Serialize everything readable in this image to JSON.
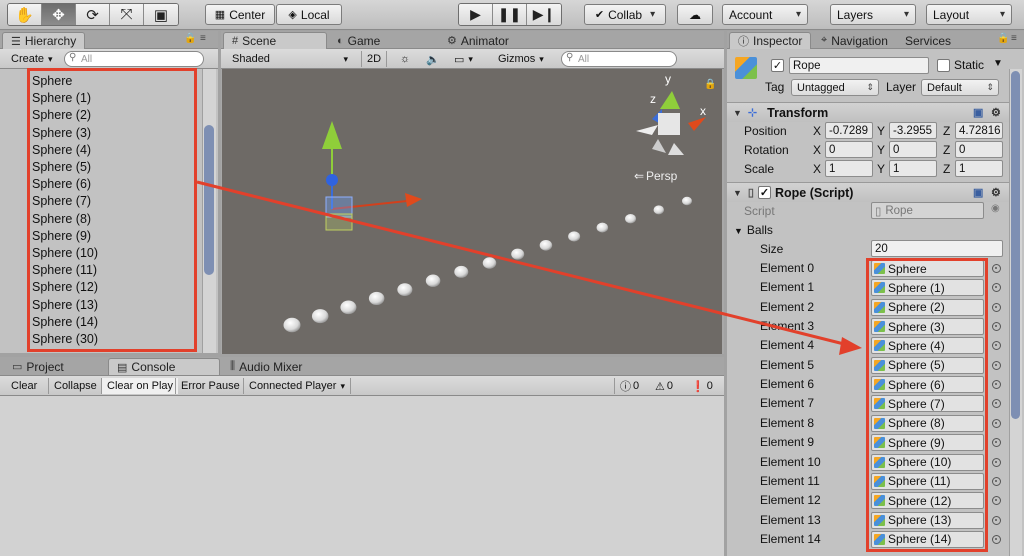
{
  "toolbar": {
    "pivot_label": "Center",
    "space_label": "Local",
    "collab_label": "Collab",
    "account_label": "Account",
    "layers_label": "Layers",
    "layout_label": "Layout"
  },
  "hierarchy": {
    "tab_label": "Hierarchy",
    "create_label": "Create",
    "search_placeholder": "All",
    "items": [
      "Sphere",
      "Sphere (1)",
      "Sphere (2)",
      "Sphere (3)",
      "Sphere (4)",
      "Sphere (5)",
      "Sphere (6)",
      "Sphere (7)",
      "Sphere (8)",
      "Sphere (9)",
      "Sphere (10)",
      "Sphere (11)",
      "Sphere (12)",
      "Sphere (13)",
      "Sphere (14)",
      "Sphere (30)"
    ]
  },
  "scene": {
    "tabs": [
      "Scene",
      "Game",
      "Animator"
    ],
    "shading_mode": "Shaded",
    "mode_2d": "2D",
    "gizmos_label": "Gizmos",
    "search_placeholder": "All",
    "persp_label": "Persp",
    "axis_labels": {
      "y": "y",
      "z": "z",
      "x": "x"
    }
  },
  "bottom": {
    "tabs": [
      "Project",
      "Console",
      "Audio Mixer"
    ],
    "buttons": [
      "Clear",
      "Collapse",
      "Clear on Play",
      "Error Pause",
      "Connected Player"
    ],
    "counts": {
      "errors": "0",
      "warnings": "0",
      "messages": "0"
    }
  },
  "inspector": {
    "tabs": [
      "Inspector",
      "Navigation",
      "Services"
    ],
    "object_name": "Rope",
    "static_label": "Static",
    "tag_label": "Tag",
    "tag_value": "Untagged",
    "layer_label": "Layer",
    "layer_value": "Default",
    "transform": {
      "title": "Transform",
      "position_label": "Position",
      "rotation_label": "Rotation",
      "scale_label": "Scale",
      "position": {
        "x": "-0.7289",
        "y": "-3.2955",
        "z": "4.72816"
      },
      "rotation": {
        "x": "0",
        "y": "0",
        "z": "0"
      },
      "scale": {
        "x": "1",
        "y": "1",
        "z": "1"
      }
    },
    "rope_script": {
      "title": "Rope (Script)",
      "script_label": "Script",
      "script_value": "Rope",
      "balls_label": "Balls",
      "size_label": "Size",
      "size_value": "20",
      "elements": [
        {
          "label": "Element 0",
          "value": "Sphere"
        },
        {
          "label": "Element 1",
          "value": "Sphere (1)"
        },
        {
          "label": "Element 2",
          "value": "Sphere (2)"
        },
        {
          "label": "Element 3",
          "value": "Sphere (3)"
        },
        {
          "label": "Element 4",
          "value": "Sphere (4)"
        },
        {
          "label": "Element 5",
          "value": "Sphere (5)"
        },
        {
          "label": "Element 6",
          "value": "Sphere (6)"
        },
        {
          "label": "Element 7",
          "value": "Sphere (7)"
        },
        {
          "label": "Element 8",
          "value": "Sphere (8)"
        },
        {
          "label": "Element 9",
          "value": "Sphere (9)"
        },
        {
          "label": "Element 10",
          "value": "Sphere (10)"
        },
        {
          "label": "Element 11",
          "value": "Sphere (11)"
        },
        {
          "label": "Element 12",
          "value": "Sphere (12)"
        },
        {
          "label": "Element 13",
          "value": "Sphere (13)"
        },
        {
          "label": "Element 14",
          "value": "Sphere (14)"
        }
      ]
    }
  },
  "colors": {
    "annotation_red": "#e2402b",
    "scene_bg": "#6e6a66",
    "panel_bg": "#c2c2c2"
  }
}
